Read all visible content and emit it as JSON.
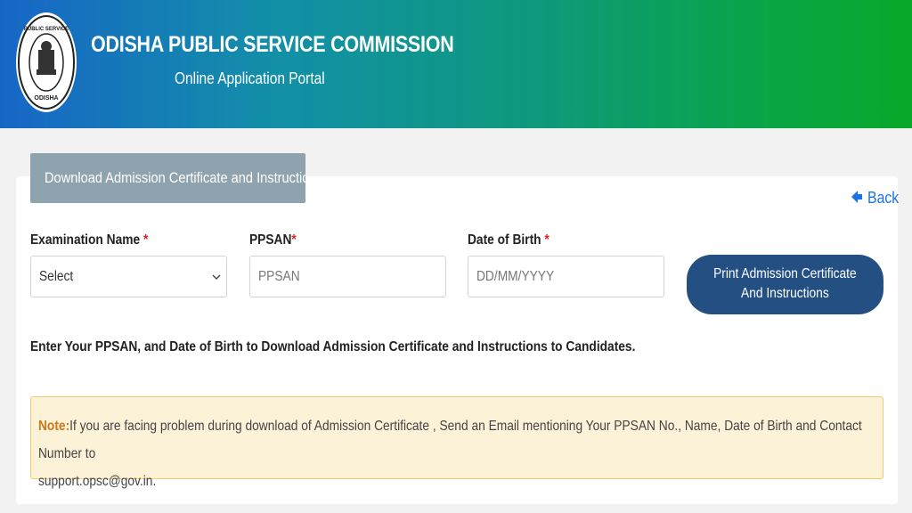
{
  "header": {
    "title": "ODISHA PUBLIC SERVICE COMMISSION",
    "subtitle": "Online Application Portal",
    "logo_text": "PUBLIC SERVICE COMMISSION ODISHA",
    "logo_icon": "state-emblem-seal-icon"
  },
  "tab": {
    "label": "Download Admission Certificate and Instructions"
  },
  "back": {
    "label": "Back",
    "icon": "arrow-left-icon"
  },
  "form": {
    "exam": {
      "label": "Examination Name",
      "required": "*",
      "value": "Select"
    },
    "ppsan": {
      "label": "PPSAN",
      "required": "*",
      "placeholder": "PPSAN"
    },
    "dob": {
      "label": "Date of Birth",
      "required": "*",
      "placeholder": "DD/MM/YYYY"
    },
    "submit": {
      "line1": "Print Admission Certificate",
      "line2": "And Instructions"
    }
  },
  "instruction": "Enter Your PPSAN, and Date of Birth to Download Admission Certificate and Instructions to Candidates.",
  "note": {
    "label": "Note:",
    "text": "If you are facing problem during download of Admission Certificate , Send an Email mentioning Your PPSAN No., Name, Date of Birth and Contact Number to",
    "email": "support.opsc@gov.in."
  },
  "colors": {
    "header_gradient_start": "#1766c6",
    "header_gradient_end": "#08a82a",
    "tab_bg": "#8ea3ad",
    "button_bg": "#244f83",
    "link": "#1a73e8",
    "required": "#d9241c",
    "note_bg": "#fcf2d8",
    "note_border": "#f5c86a"
  }
}
